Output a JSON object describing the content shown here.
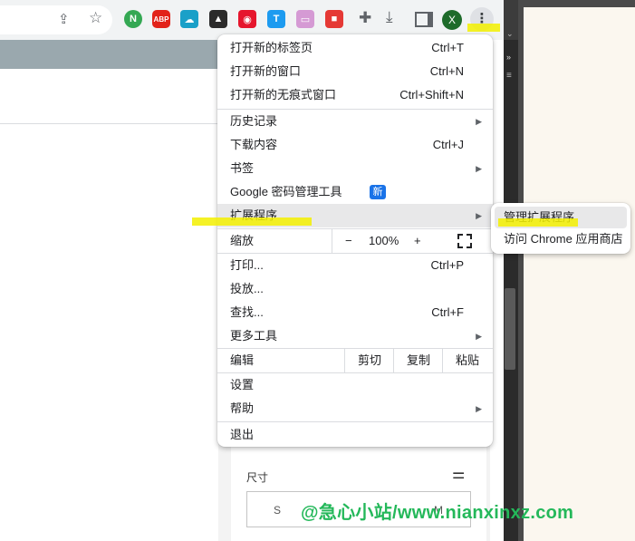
{
  "toolbar": {
    "extensions": [
      {
        "name": "nanx-extension-icon",
        "glyph": "N",
        "color": "#34a853"
      },
      {
        "name": "adblock-plus-icon",
        "glyph": "ABP",
        "color": "#e2231a"
      },
      {
        "name": "cloud-extension-icon",
        "glyph": "☁",
        "color": "#1aa0c8"
      },
      {
        "name": "triangle-extension-icon",
        "glyph": "▲",
        "color": "#2b2b2b"
      },
      {
        "name": "weibo-extension-icon",
        "glyph": "◉",
        "color": "#e6162d"
      },
      {
        "name": "t-extension-icon",
        "glyph": "T",
        "color": "#1d9bf0"
      },
      {
        "name": "card-extension-icon",
        "glyph": "▭",
        "color": "#d59ad4"
      },
      {
        "name": "red-extension-icon",
        "glyph": "■",
        "color": "#e53935"
      }
    ],
    "profile_initial": "X"
  },
  "menu": {
    "new_tab": {
      "label": "打开新的标签页",
      "shortcut": "Ctrl+T"
    },
    "new_window": {
      "label": "打开新的窗口",
      "shortcut": "Ctrl+N"
    },
    "incognito": {
      "label": "打开新的无痕式窗口",
      "shortcut": "Ctrl+Shift+N"
    },
    "history": {
      "label": "历史记录"
    },
    "downloads": {
      "label": "下载内容",
      "shortcut": "Ctrl+J"
    },
    "bookmarks": {
      "label": "书签"
    },
    "password_manager": {
      "label": "Google 密码管理工具",
      "badge": "新"
    },
    "extensions": {
      "label": "扩展程序"
    },
    "zoom": {
      "label": "缩放",
      "minus": "−",
      "value": "100%",
      "plus": "+"
    },
    "print": {
      "label": "打印...",
      "shortcut": "Ctrl+P"
    },
    "cast": {
      "label": "投放..."
    },
    "find": {
      "label": "查找...",
      "shortcut": "Ctrl+F"
    },
    "more_tools": {
      "label": "更多工具"
    },
    "edit": {
      "label": "编辑",
      "cut": "剪切",
      "copy": "复制",
      "paste": "粘贴"
    },
    "settings": {
      "label": "设置"
    },
    "help": {
      "label": "帮助"
    },
    "exit": {
      "label": "退出"
    }
  },
  "submenu": {
    "manage_extensions": "管理扩展程序",
    "visit_store": "访问 Chrome 应用商店"
  },
  "background_panel": {
    "size_label": "尺寸",
    "size_option_s": "S",
    "size_option_m": "M"
  },
  "watermark": "@急心小站/www.nianxinxz.com",
  "colors": {
    "highlight_marker": "#f3f000",
    "new_badge": "#1a73e8",
    "watermark": "#24b85a",
    "profile": "#1e6b2a"
  }
}
